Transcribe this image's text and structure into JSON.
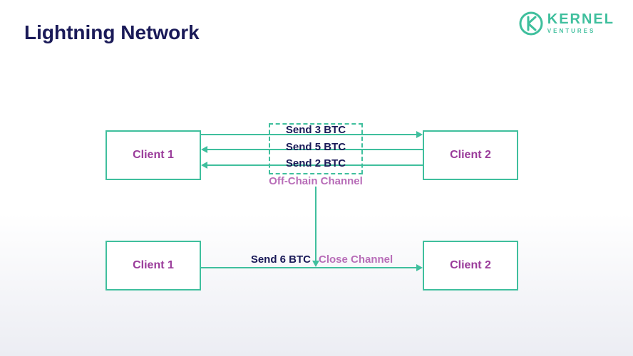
{
  "title": "Lightning Network",
  "brand": {
    "name": "KERNEL",
    "tagline": "VENTURES"
  },
  "colors": {
    "accent": "#3fbf9d",
    "title": "#1a1a58",
    "nodeText": "#9a3b9a",
    "secondaryPurple": "#b86db8"
  },
  "topRow": {
    "leftNode": "Client 1",
    "rightNode": "Client 2",
    "channelLabel": "Off-Chain Channel",
    "txs": [
      {
        "label": "Send 3 BTC",
        "direction": "right"
      },
      {
        "label": "Send 5 BTC",
        "direction": "left"
      },
      {
        "label": "Send 2 BTC",
        "direction": "left"
      }
    ]
  },
  "bottomRow": {
    "leftNode": "Client 1",
    "rightNode": "Client 2",
    "leftLabel": "Send 6 BTC",
    "rightLabel": "Close Channel"
  }
}
